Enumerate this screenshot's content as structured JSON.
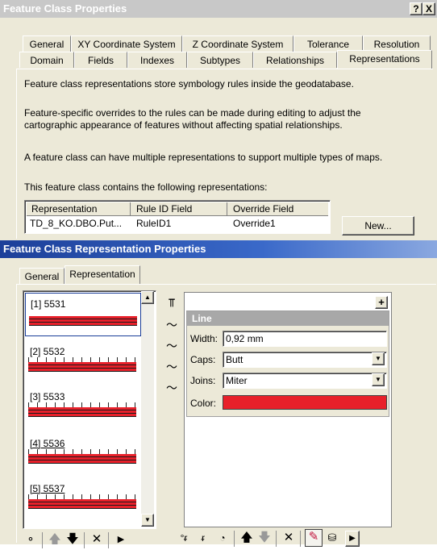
{
  "dialog1": {
    "title": "Feature Class Properties",
    "help_button": "?",
    "close_button": "X",
    "tabs_row1": [
      "General",
      "XY Coordinate System",
      "Z Coordinate System",
      "Tolerance",
      "Resolution"
    ],
    "tabs_row2": [
      "Domain",
      "Fields",
      "Indexes",
      "Subtypes",
      "Relationships",
      "Representations"
    ],
    "para1": "Feature class representations store symbology rules inside the geodatabase.",
    "para2a": "Feature-specific overrides to the rules can be made during editing to adjust the",
    "para2b": "cartographic appearance of features without affecting spatial relationships.",
    "para3": "A feature class can have multiple representations to support multiple types of maps.",
    "para4": "This feature class contains the following representations:",
    "table": {
      "headers": [
        "Representation",
        "Rule ID Field",
        "Override Field"
      ],
      "row": [
        "TD_8_KO.DBO.Put...",
        "RuleID1",
        "Override1"
      ]
    },
    "new_button": "New..."
  },
  "dialog2": {
    "title": "Feature Class Representation Properties",
    "tabs": [
      "General",
      "Representation"
    ],
    "rules": [
      "[1] 5531",
      "[2] 5532",
      "[3] 5533",
      "[4] 5536",
      "[5] 5537"
    ],
    "panel_add": "+",
    "line_header": "Line",
    "width_label": "Width:",
    "width_value": "0,92 mm",
    "caps_label": "Caps:",
    "caps_value": "Butt",
    "joins_label": "Joins:",
    "joins_value": "Miter",
    "color_label": "Color:",
    "color_value": "#e8202a"
  }
}
